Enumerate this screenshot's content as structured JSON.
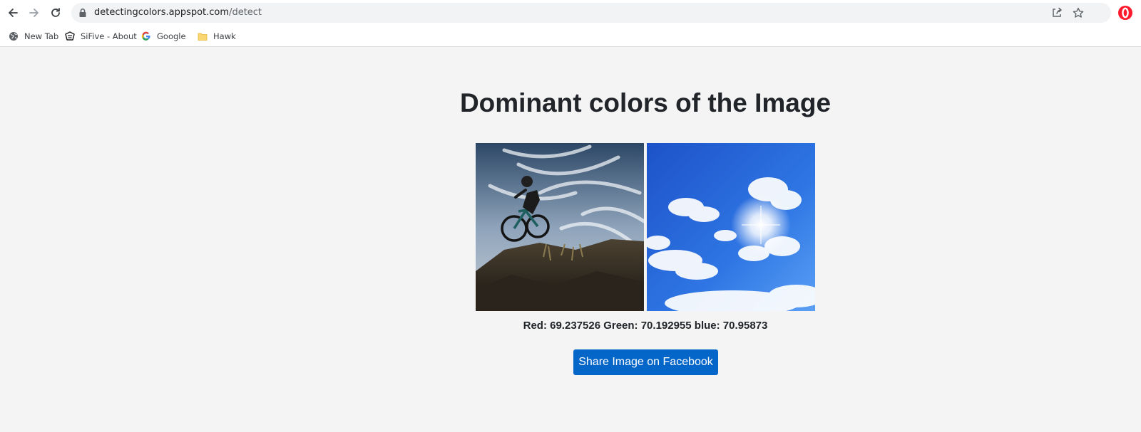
{
  "browser": {
    "url_host": "detectingcolors.appspot.com",
    "url_path": "/detect",
    "bookmarks": [
      {
        "label": "New Tab",
        "icon": "globe-icon"
      },
      {
        "label": "SiFive - About",
        "icon": "sifive-logo-icon"
      },
      {
        "label": "Google",
        "icon": "google-g-icon"
      },
      {
        "label": "Hawk",
        "icon": "folder-icon"
      }
    ]
  },
  "page": {
    "title": "Dominant colors of the Image",
    "images": [
      {
        "subject": "mountain biker on rocky hillside under cloudy sky"
      },
      {
        "subject": "blue sky with white clouds and sun"
      }
    ],
    "stats": "Red: 69.237526 Green: 70.192955 blue: 70.95873",
    "share_button": "Share Image on Facebook"
  },
  "colors": {
    "accent": "#0466c8",
    "background": "#f4f4f5",
    "text": "#212529"
  }
}
